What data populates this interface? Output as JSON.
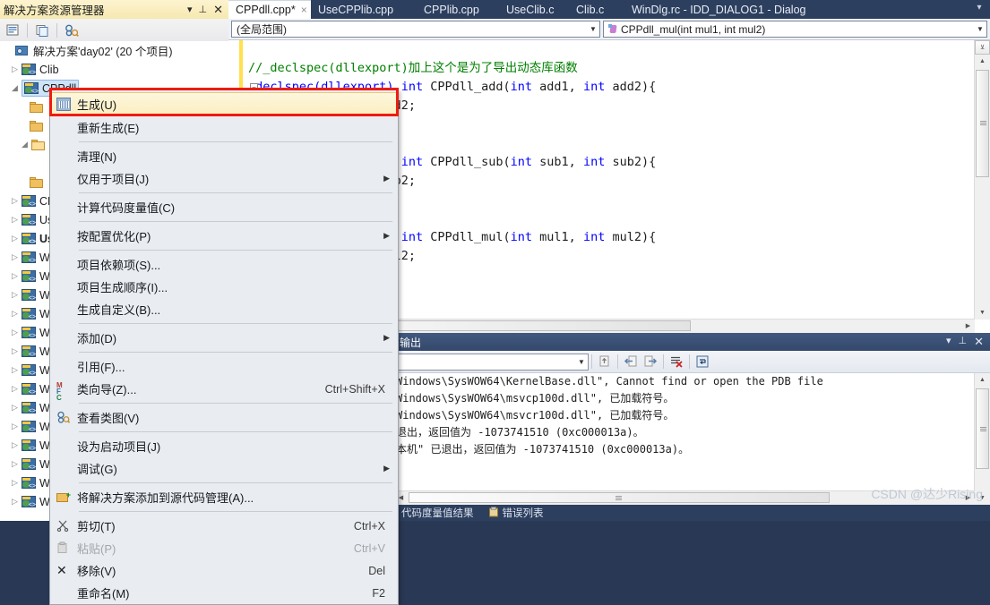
{
  "solution_explorer": {
    "title": "解决方案资源管理器",
    "title_controls": [
      "chevron-down",
      "pin",
      "close"
    ],
    "toolbar_icons": [
      "properties-icon",
      "show-all-files-icon",
      "class-view-icon"
    ],
    "root": "解决方案'day02' (20 个项目)",
    "tree": [
      {
        "label": "Clib",
        "icon": "project-icon",
        "indent": 1,
        "expander": "collapsed",
        "selected": false
      },
      {
        "label": "CPPdll",
        "icon": "project-icon",
        "indent": 1,
        "expander": "expanded",
        "selected": true
      },
      {
        "label": "CP",
        "icon": "project-icon",
        "indent": 1,
        "expander": "collapsed",
        "selected": false
      },
      {
        "label": "Us",
        "icon": "project-icon",
        "indent": 1,
        "expander": "collapsed",
        "selected": false
      },
      {
        "label": "Us",
        "icon": "project-icon",
        "indent": 1,
        "expander": "collapsed",
        "selected": false,
        "bold": true
      },
      {
        "label": "Wi",
        "icon": "project-icon",
        "indent": 1,
        "expander": "collapsed",
        "selected": false
      },
      {
        "label": "Wi",
        "icon": "project-icon",
        "indent": 1,
        "expander": "collapsed",
        "selected": false
      },
      {
        "label": "Wi",
        "icon": "project-icon",
        "indent": 1,
        "expander": "collapsed",
        "selected": false
      },
      {
        "label": "Wi",
        "icon": "project-icon",
        "indent": 1,
        "expander": "collapsed",
        "selected": false
      },
      {
        "label": "Wi",
        "icon": "project-icon",
        "indent": 1,
        "expander": "collapsed",
        "selected": false
      },
      {
        "label": "Wi",
        "icon": "project-icon",
        "indent": 1,
        "expander": "collapsed",
        "selected": false
      },
      {
        "label": "Wi",
        "icon": "project-icon",
        "indent": 1,
        "expander": "collapsed",
        "selected": false
      },
      {
        "label": "Wi",
        "icon": "project-icon",
        "indent": 1,
        "expander": "collapsed",
        "selected": false
      },
      {
        "label": "Wi",
        "icon": "project-icon",
        "indent": 1,
        "expander": "collapsed",
        "selected": false
      },
      {
        "label": "Wi",
        "icon": "project-icon",
        "indent": 1,
        "expander": "collapsed",
        "selected": false
      },
      {
        "label": "Wi",
        "icon": "project-icon",
        "indent": 1,
        "expander": "collapsed",
        "selected": false
      },
      {
        "label": "Wi",
        "icon": "project-icon",
        "indent": 1,
        "expander": "collapsed",
        "selected": false
      },
      {
        "label": "Wi",
        "icon": "project-icon",
        "indent": 1,
        "expander": "collapsed",
        "selected": false
      },
      {
        "label": "Wi",
        "icon": "project-icon",
        "indent": 1,
        "expander": "collapsed",
        "selected": false
      }
    ]
  },
  "tabs": [
    {
      "label": "CPPdll.cpp*",
      "active": true,
      "close": "×"
    },
    {
      "label": "UseCPPlib.cpp",
      "active": false
    },
    {
      "label": "CPPlib.cpp",
      "active": false
    },
    {
      "label": "UseClib.c",
      "active": false
    },
    {
      "label": "Clib.c",
      "active": false
    },
    {
      "label": "WinDlg.rc - IDD_DIALOG1 - Dialog",
      "active": false
    }
  ],
  "tab_overflow_icon": "chevron-down-icon",
  "navbar": {
    "scope_value": "(全局范围)",
    "member_value": "CPPdll_mul(int mul1, int mul2)",
    "member_icon": "method-icon"
  },
  "editor": {
    "lines": [
      {
        "text": "",
        "kind": "blank"
      },
      {
        "text": "//_declspec(dllexport)加上这个是为了导出动态库函数",
        "kind": "comment"
      },
      {
        "text": "_declspec(dllexport) int CPPdll_add(int add1, int add2){",
        "kind": "code",
        "fold": true
      },
      {
        "text": "    return add1 + add2;",
        "kind": "code"
      },
      {
        "text": "}",
        "kind": "code"
      },
      {
        "text": "",
        "kind": "blank"
      },
      {
        "text": "_declspec(dllexport) int CPPdll_sub(int sub1, int sub2){",
        "kind": "code",
        "fold": true
      },
      {
        "text": "    return sub1 - sub2;",
        "kind": "code"
      },
      {
        "text": "}",
        "kind": "code"
      },
      {
        "text": "",
        "kind": "blank"
      },
      {
        "text": "_declspec(dllexport) int CPPdll_mul(int mul1, int mul2){",
        "kind": "code",
        "fold": true
      },
      {
        "text": "    return mul1 * mul2;",
        "kind": "code"
      },
      {
        "text": "}",
        "kind": "code"
      }
    ],
    "visible_fragments": [
      "int CPPdll_add(int add1, int add2){",
      "dd2;",
      "int CPPdll_sub(int sub1, int sub2){",
      "ub2;",
      "int CPPdll_mul(int mul1, int mul2){",
      "ul2;"
    ]
  },
  "context_menu": {
    "items": [
      {
        "label": "生成(U)",
        "icon": "build-icon",
        "accel": "",
        "submenu": false,
        "highlight": true,
        "disabled": false
      },
      {
        "label": "重新生成(E)",
        "icon": "",
        "accel": "",
        "submenu": false,
        "highlight": false,
        "disabled": false
      },
      {
        "sep": true
      },
      {
        "label": "清理(N)",
        "icon": "",
        "accel": "",
        "submenu": false,
        "highlight": false,
        "disabled": false
      },
      {
        "label": "仅用于项目(J)",
        "icon": "",
        "accel": "",
        "submenu": true,
        "highlight": false,
        "disabled": false
      },
      {
        "sep": true
      },
      {
        "label": "计算代码度量值(C)",
        "icon": "",
        "accel": "",
        "submenu": false,
        "highlight": false,
        "disabled": false
      },
      {
        "sep": true
      },
      {
        "label": "按配置优化(P)",
        "icon": "",
        "accel": "",
        "submenu": true,
        "highlight": false,
        "disabled": false
      },
      {
        "sep": true
      },
      {
        "label": "项目依赖项(S)...",
        "icon": "",
        "accel": "",
        "submenu": false,
        "highlight": false,
        "disabled": false
      },
      {
        "label": "项目生成顺序(I)...",
        "icon": "",
        "accel": "",
        "submenu": false,
        "highlight": false,
        "disabled": false
      },
      {
        "label": "生成自定义(B)...",
        "icon": "",
        "accel": "",
        "submenu": false,
        "highlight": false,
        "disabled": false
      },
      {
        "sep": true
      },
      {
        "label": "添加(D)",
        "icon": "",
        "accel": "",
        "submenu": true,
        "highlight": false,
        "disabled": false
      },
      {
        "sep": true
      },
      {
        "label": "引用(F)...",
        "icon": "",
        "accel": "",
        "submenu": false,
        "highlight": false,
        "disabled": false
      },
      {
        "label": "类向导(Z)...",
        "icon": "mfc-class-wizard-icon",
        "accel": "Ctrl+Shift+X",
        "submenu": false,
        "highlight": false,
        "disabled": false
      },
      {
        "sep": true
      },
      {
        "label": "查看类图(V)",
        "icon": "class-diagram-icon",
        "accel": "",
        "submenu": false,
        "highlight": false,
        "disabled": false
      },
      {
        "sep": true
      },
      {
        "label": "设为启动项目(J)",
        "icon": "",
        "accel": "",
        "submenu": false,
        "highlight": false,
        "disabled": false
      },
      {
        "label": "调试(G)",
        "icon": "",
        "accel": "",
        "submenu": true,
        "highlight": false,
        "disabled": false
      },
      {
        "sep": true
      },
      {
        "label": "将解决方案添加到源代码管理(A)...",
        "icon": "source-control-icon",
        "accel": "",
        "submenu": false,
        "highlight": false,
        "disabled": false
      },
      {
        "sep": true
      },
      {
        "label": "剪切(T)",
        "icon": "scissors-icon",
        "accel": "Ctrl+X",
        "submenu": false,
        "highlight": false,
        "disabled": false
      },
      {
        "label": "粘贴(P)",
        "icon": "clipboard-icon",
        "accel": "Ctrl+V",
        "submenu": false,
        "highlight": false,
        "disabled": true
      },
      {
        "label": "移除(V)",
        "icon": "x-icon",
        "accel": "Del",
        "submenu": false,
        "highlight": false,
        "disabled": false
      },
      {
        "label": "重命名(M)",
        "icon": "",
        "accel": "F2",
        "submenu": false,
        "highlight": false,
        "disabled": false
      }
    ],
    "highlight_outline_color": "#ee1c10"
  },
  "output": {
    "title": "输出",
    "title_controls": [
      "chevron-down",
      "pin",
      "close"
    ],
    "combo_value": "",
    "toolbar_icons": [
      "find-message-icon",
      "go-to-previous-icon",
      "go-to-next-icon",
      "clear-all-icon",
      "toggle-word-wrap-icon"
    ],
    "lines": [
      "Windows\\SysWOW64\\KernelBase.dll\", Cannot find or open the PDB file",
      "Windows\\SysWOW64\\msvcp100d.dll\", 已加载符号。",
      "Windows\\SysWOW64\\msvcr100d.dll\", 已加载符号。",
      "退出，返回值为 -1073741510 (0xc000013a)。",
      "本机\" 已退出，返回值为 -1073741510 (0xc000013a)。"
    ],
    "bottom_tabs": [
      "代码度量值结果",
      "错误列表"
    ]
  },
  "watermark": "CSDN @达少Rising",
  "colors": {
    "chrome_dark": "#2d3f5e",
    "panel_title_gold": "#f6e8b0",
    "menu_bg": "#e9ecf0",
    "menu_highlight": "#fbeec0",
    "highlight_outline": "#ee1c10",
    "keyword_blue": "#0000ff",
    "comment_green": "#008000",
    "selection_blue": "#cfe3f7"
  }
}
